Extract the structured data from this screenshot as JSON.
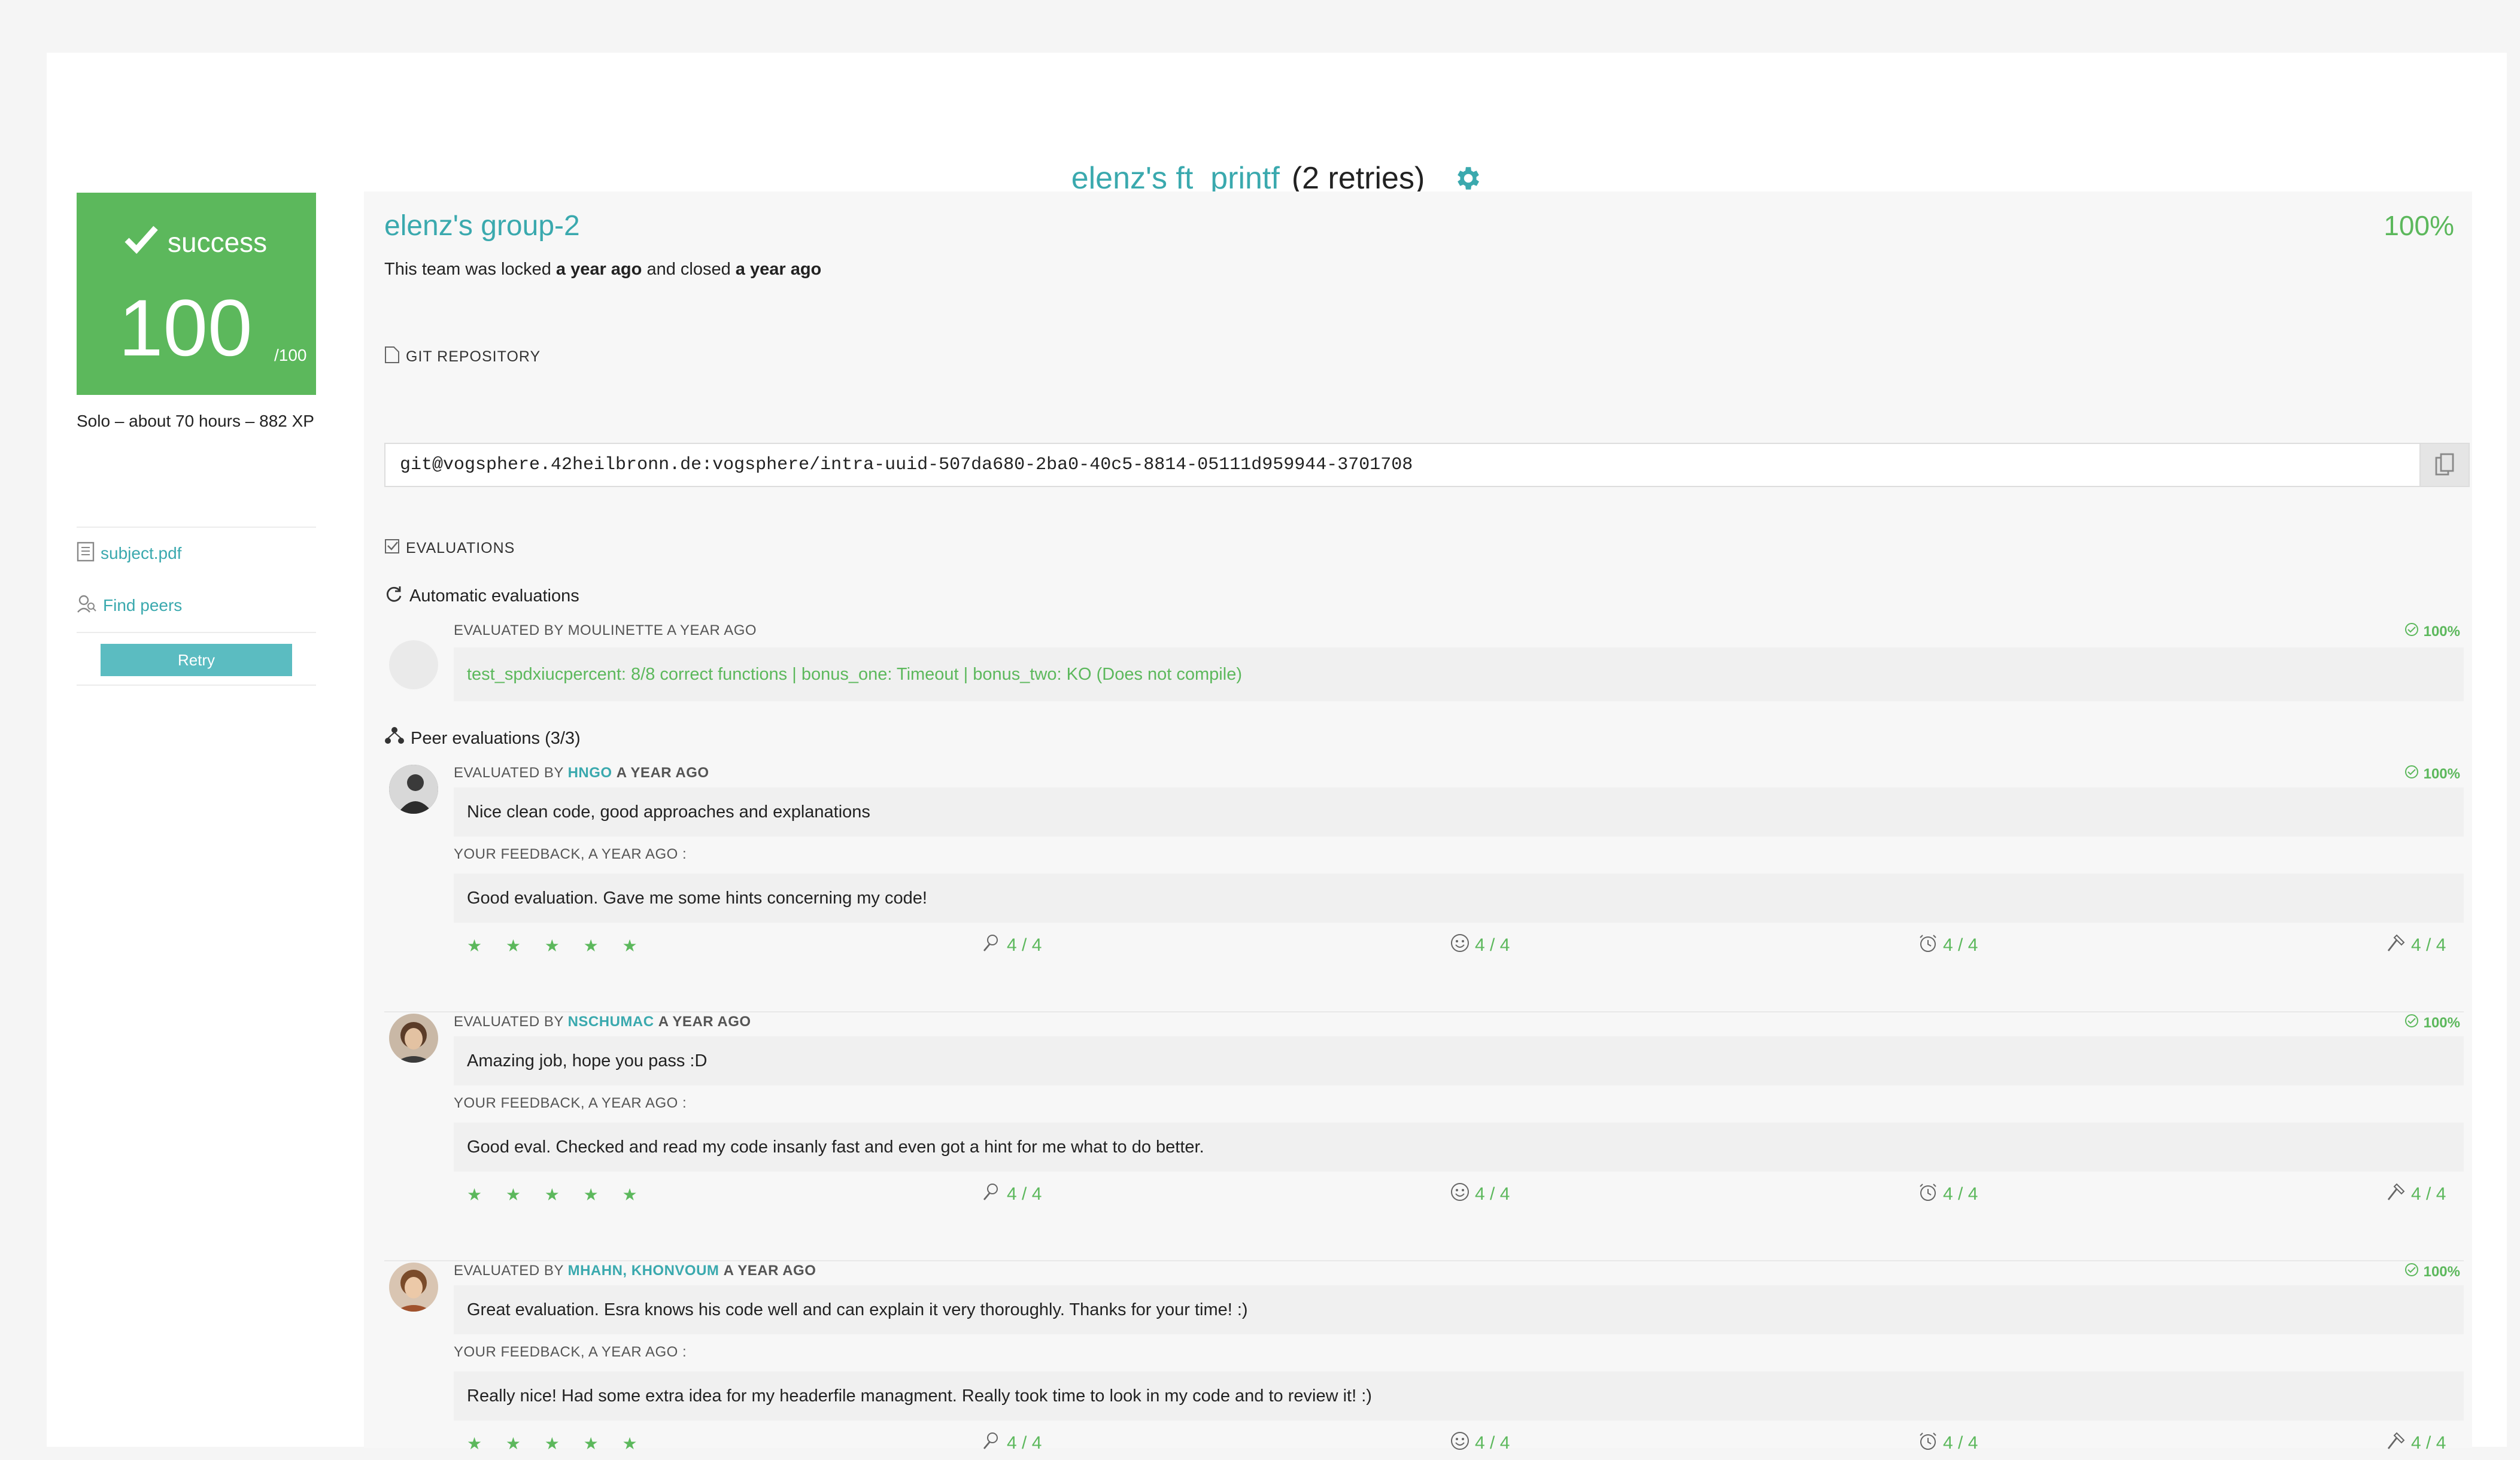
{
  "title": {
    "project": "elenz's ft_printf",
    "retries": "(2 retries)"
  },
  "status": {
    "label": "success",
    "score": "100",
    "max": "/100"
  },
  "sidebar": {
    "meta": "Solo – about 70 hours – 882 XP",
    "subject_link": "subject.pdf",
    "find_peers_link": "Find peers",
    "retry_button": "Retry"
  },
  "team": {
    "name": "elenz's group-2",
    "percent": "100%",
    "locked_prefix": "This team was locked",
    "locked_when": "a year ago",
    "closed_prefix": "and closed",
    "closed_when": "a year ago"
  },
  "git": {
    "label": "GIT REPOSITORY",
    "url": "git@vogsphere.42heilbronn.de:vogsphere/intra-uuid-507da680-2ba0-40c5-8814-05111d959944-3701708"
  },
  "evaluations": {
    "label": "EVALUATIONS",
    "automatic_heading": "Automatic evaluations",
    "peer_heading": "Peer evaluations (3/3)",
    "automatic": {
      "by_prefix": "EVALUATED BY MOULINETTE A YEAR AGO",
      "percent": "100%",
      "result": "test_spdxiucpercent: 8/8 correct functions | bonus_one: Timeout | bonus_two: KO (Does not compile)"
    },
    "peers": [
      {
        "by_prefix": "EVALUATED BY",
        "user": "HNGO",
        "when": "A YEAR AGO",
        "percent": "100%",
        "comment": "Nice clean code, good approaches and explanations",
        "feedback_label": "YOUR FEEDBACK, A YEAR AGO :",
        "feedback": "Good evaluation. Gave me some hints concerning my code!",
        "stars": "★ ★ ★ ★ ★",
        "r1": "4 / 4",
        "r2": "4 / 4",
        "r3": "4 / 4",
        "r4": "4 / 4"
      },
      {
        "by_prefix": "EVALUATED BY",
        "user": "NSCHUMAC",
        "when": "A YEAR AGO",
        "percent": "100%",
        "comment": "Amazing job, hope you pass :D",
        "feedback_label": "YOUR FEEDBACK, A YEAR AGO :",
        "feedback": "Good eval. Checked and read my code insanly fast and even got a hint for me what to do better.",
        "stars": "★ ★ ★ ★ ★",
        "r1": "4 / 4",
        "r2": "4 / 4",
        "r3": "4 / 4",
        "r4": "4 / 4"
      },
      {
        "by_prefix": "EVALUATED BY",
        "user": "MHAHN, KHONVOUM",
        "when": "A YEAR AGO",
        "percent": "100%",
        "comment": "Great evaluation. Esra knows his code well and can explain it very thoroughly. Thanks for your time! :)",
        "feedback_label": "YOUR FEEDBACK, A YEAR AGO :",
        "feedback": "Really nice! Had some extra idea for my headerfile managment. Really took time to look in my code and to review it! :)",
        "stars": "★ ★ ★ ★ ★",
        "r1": "4 / 4",
        "r2": "4 / 4",
        "r3": "4 / 4",
        "r4": "4 / 4"
      }
    ]
  },
  "colors": {
    "accent": "#3aa9ae",
    "success": "#5cb85c",
    "retry": "#5bbcc1"
  },
  "icons": [
    "gear-icon",
    "checkmark-icon",
    "document-icon",
    "find-peers-icon",
    "file-icon",
    "copy-icon",
    "checkbox-icon",
    "refresh-icon",
    "peers-icon",
    "check-circle-icon",
    "star-icon",
    "pen-icon",
    "smiley-icon",
    "alarm-icon",
    "hammer-icon"
  ]
}
